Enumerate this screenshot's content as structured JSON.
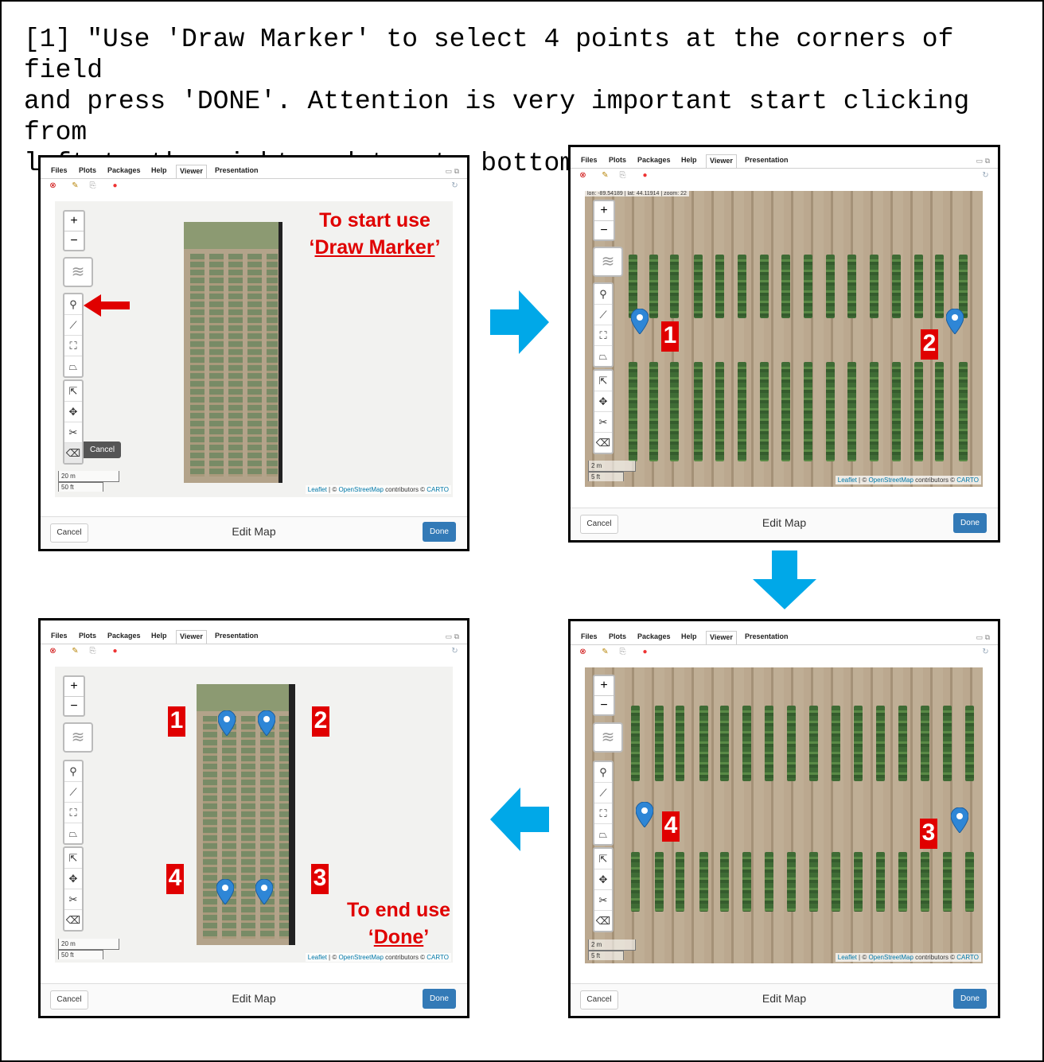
{
  "caption": "[1] \"Use 'Draw Marker' to select 4 points at the corners of field\nand press 'DONE'. Attention is very important start clicking from\nleft to the right and top to bottom.\"",
  "tabs": [
    "Files",
    "Plots",
    "Packages",
    "Help",
    "Viewer",
    "Presentation"
  ],
  "active_tab": "Viewer",
  "dialog": {
    "cancel": "Cancel",
    "title": "Edit Map",
    "done": "Done"
  },
  "map": {
    "zoom_in": "+",
    "zoom_out": "−",
    "cancel_tip": "Cancel",
    "scale_wide": [
      "20 m",
      "50 ft"
    ],
    "scale_close": [
      "2 m",
      "5 ft"
    ],
    "attribution": {
      "leaflet": "Leaflet",
      "sep1": " | © ",
      "osm": "OpenStreetMap",
      "contrib": " contributors © ",
      "carto": "CARTO"
    },
    "coords": "lon: -89.54189 | lat: 44.11914 | zoom: 22"
  },
  "annotations": {
    "start_line1": "To start use",
    "start_line2_q1": "‘",
    "start_line2": "Draw Marker",
    "start_line2_q2": "’",
    "end_line1": "To end use",
    "end_line2_q1": "‘",
    "end_line2": "Done",
    "end_line2_q2": "’",
    "marker_numbers": [
      "1",
      "2",
      "3",
      "4"
    ]
  },
  "colors": {
    "done_button": "#337ab7",
    "annotation_red": "#e00000",
    "flow_arrow": "#00a8e8",
    "marker": "#2e86d6"
  },
  "icons": [
    "zoom-in-icon",
    "zoom-out-icon",
    "layers-icon",
    "marker-icon",
    "polyline-icon",
    "rectangle-icon",
    "polygon-icon",
    "edit-icon",
    "move-icon",
    "cut-icon",
    "erase-icon"
  ]
}
